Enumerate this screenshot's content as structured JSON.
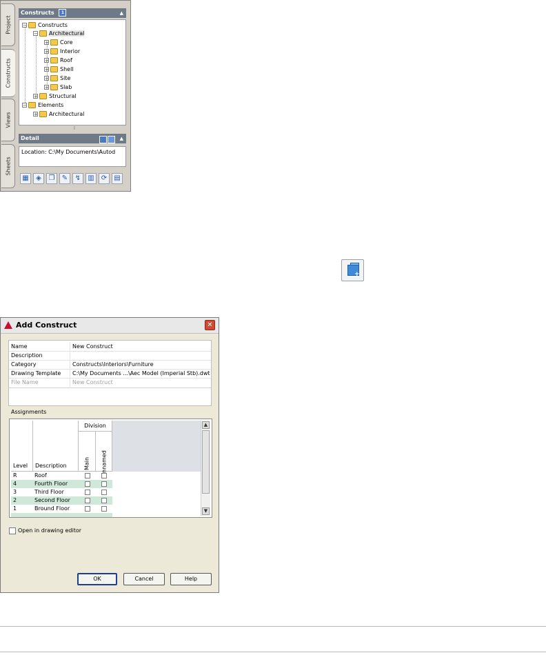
{
  "navigator": {
    "tabs": [
      "Project",
      "Constructs",
      "Views",
      "Sheets"
    ],
    "active_tab": "Constructs",
    "constructs_header": "Constructs",
    "badge": "1",
    "tree": [
      {
        "label": "Constructs",
        "toggle": "⊟"
      },
      {
        "label": "Architectural",
        "toggle": "⊟"
      },
      {
        "label": "Core",
        "toggle": "⊞"
      },
      {
        "label": "Interior",
        "toggle": "⊞"
      },
      {
        "label": "Roof",
        "toggle": "⊞"
      },
      {
        "label": "Shell",
        "toggle": "⊞"
      },
      {
        "label": "Site",
        "toggle": "⊞"
      },
      {
        "label": "Slab",
        "toggle": "⊞"
      },
      {
        "label": "Structural",
        "toggle": "⊞"
      },
      {
        "label": "Elements",
        "toggle": "⊟"
      },
      {
        "label": "Architectural",
        "toggle": "⊞"
      }
    ],
    "detail_header": "Detail",
    "detail_text": "Location: C:\\My Documents\\Autod",
    "toolbar_icons": [
      "add-construct-icon",
      "add-element-icon",
      "copy-construct-icon",
      "edit-icon",
      "repath-icon",
      "layout-icon",
      "refresh-icon",
      "close-project-icon"
    ]
  },
  "add_button_icon": "add-construct-icon",
  "dialog": {
    "title": "Add Construct",
    "properties": [
      {
        "key": "Name",
        "value": "New Construct"
      },
      {
        "key": "Description",
        "value": ""
      },
      {
        "key": "Category",
        "value": "Constructs\\Interiors\\Furniture"
      },
      {
        "key": "Drawing Template",
        "value": "C:\\My Documents ...\\Aec Model (Imperial Stb).dwt"
      },
      {
        "key": "File Name",
        "value": "New Construct"
      }
    ],
    "assignments_label": "Assignments",
    "columns": {
      "level": "Level",
      "description": "Description",
      "division": "Division",
      "main": "Main",
      "unnamed": "Unnamed"
    },
    "rows": [
      {
        "level": "R",
        "description": "Roof"
      },
      {
        "level": "4",
        "description": "Fourth Floor"
      },
      {
        "level": "3",
        "description": "Third Floor"
      },
      {
        "level": "2",
        "description": "Second Floor"
      },
      {
        "level": "1",
        "description": "Bround Floor"
      }
    ],
    "open_in_editor": "Open in drawing editor",
    "buttons": {
      "ok": "OK",
      "cancel": "Cancel",
      "help": "Help"
    }
  }
}
